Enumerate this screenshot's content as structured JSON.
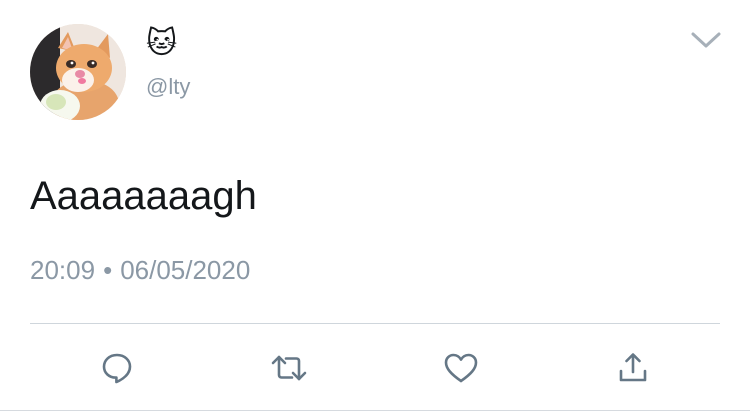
{
  "tweet": {
    "author": {
      "display_name": "🐱",
      "handle": "@lty",
      "avatar_icon": "crying-cat-avatar"
    },
    "text": "Aaaaaaaagh",
    "time": "20:09",
    "separator": "•",
    "date": "06/05/2020",
    "menu_icon": "chevron-down-icon"
  },
  "actions": [
    {
      "name": "reply",
      "icon": "reply-bubble-icon"
    },
    {
      "name": "retweet",
      "icon": "retweet-icon"
    },
    {
      "name": "like",
      "icon": "heart-icon"
    },
    {
      "name": "share",
      "icon": "share-icon"
    }
  ],
  "colors": {
    "text": "#14171a",
    "secondary_text": "#8b98a5",
    "icon": "#657786",
    "divider": "#cfd6dc"
  }
}
